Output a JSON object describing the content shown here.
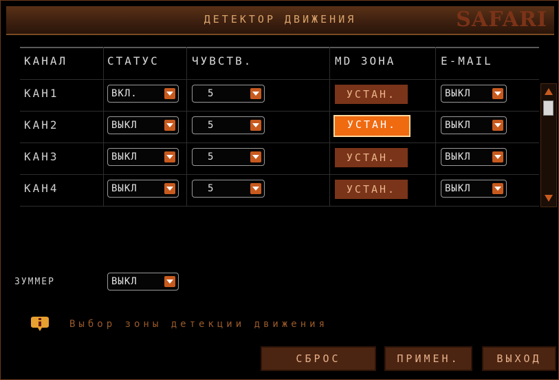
{
  "window": {
    "title": "ДЕТЕКТОР ДВИЖЕНИЯ",
    "brand": "SAFARI"
  },
  "columns": [
    "КАНАЛ",
    "СТАТУС",
    "ЧУВСТВ.",
    "MD ЗОНА",
    "E-MAIL"
  ],
  "rows": [
    {
      "channel": "КАН1",
      "status": "ВКЛ.",
      "sensitivity": "5",
      "zone": "УСТАН.",
      "email": "ВЫКЛ"
    },
    {
      "channel": "КАН2",
      "status": "ВЫКЛ",
      "sensitivity": "5",
      "zone": "УСТАН.",
      "email": "ВЫКЛ"
    },
    {
      "channel": "КАН3",
      "status": "ВЫКЛ",
      "sensitivity": "5",
      "zone": "УСТАН.",
      "email": "ВЫКЛ"
    },
    {
      "channel": "КАН4",
      "status": "ВЫКЛ",
      "sensitivity": "5",
      "zone": "УСТАН.",
      "email": "ВЫКЛ"
    }
  ],
  "buzzer": {
    "label": "ЗУММЕР",
    "value": "ВЫКЛ"
  },
  "hint": "Выбор зоны детекции движения",
  "buttons": {
    "reset": "СБРОС",
    "apply": "ПРИМЕН.",
    "exit": "ВЫХОД"
  },
  "colors": {
    "accent": "#c85a1e",
    "active": "#f06a10",
    "zone_button": "#7a3419",
    "title_bar": "#3e2010"
  }
}
